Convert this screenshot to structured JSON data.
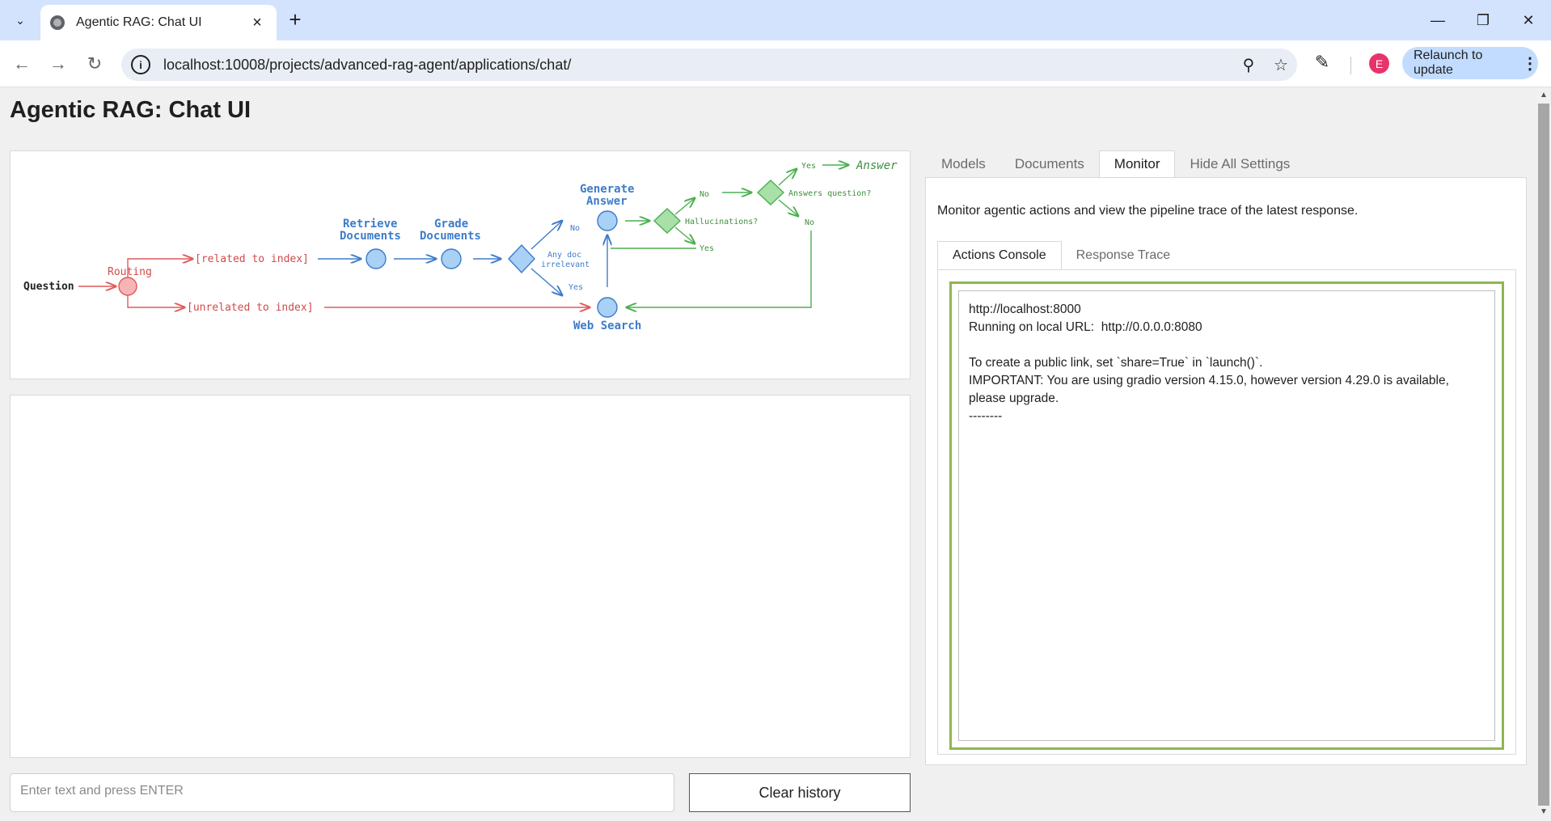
{
  "browser": {
    "tab_title": "Agentic RAG: Chat UI",
    "url": "localhost:10008/projects/advanced-rag-agent/applications/chat/",
    "profile_initial": "E",
    "relaunch_label": "Relaunch to update"
  },
  "page": {
    "title": "Agentic RAG: Chat UI"
  },
  "diagram": {
    "question": "Question",
    "routing": "Routing",
    "related": "[related to index]",
    "unrelated": "[unrelated to index]",
    "retrieve_1": "Retrieve",
    "retrieve_2": "Documents",
    "grade_1": "Grade",
    "grade_2": "Documents",
    "generate_1": "Generate",
    "generate_2": "Answer",
    "any_doc_1": "Any doc",
    "any_doc_2": "irrelevant",
    "no_1": "No",
    "yes_1": "Yes",
    "hallucinations": "Hallucinations?",
    "no_2": "No",
    "yes_2": "Yes",
    "answers_question": "Answers question?",
    "yes_3": "Yes",
    "answer": "Answer",
    "no_3": "No",
    "web_search": "Web Search"
  },
  "chat": {
    "input_placeholder": "Enter text and press ENTER",
    "clear_label": "Clear history"
  },
  "settings": {
    "tabs": [
      "Models",
      "Documents",
      "Monitor",
      "Hide All Settings"
    ],
    "monitor_desc": "Monitor agentic actions and view the pipeline trace of the latest response.",
    "subtabs": [
      "Actions Console",
      "Response Trace"
    ],
    "console_text": "http://localhost:8000\nRunning on local URL:  http://0.0.0.0:8080\n\nTo create a public link, set `share=True` in `launch()`.\nIMPORTANT: You are using gradio version 4.15.0, however version 4.29.0 is available, please upgrade.\n--------"
  },
  "colors": {
    "accent_green": "#8fb650",
    "diagram_blue": "#3d7cc9",
    "diagram_red": "#e05a5a",
    "diagram_green": "#4caf50"
  }
}
